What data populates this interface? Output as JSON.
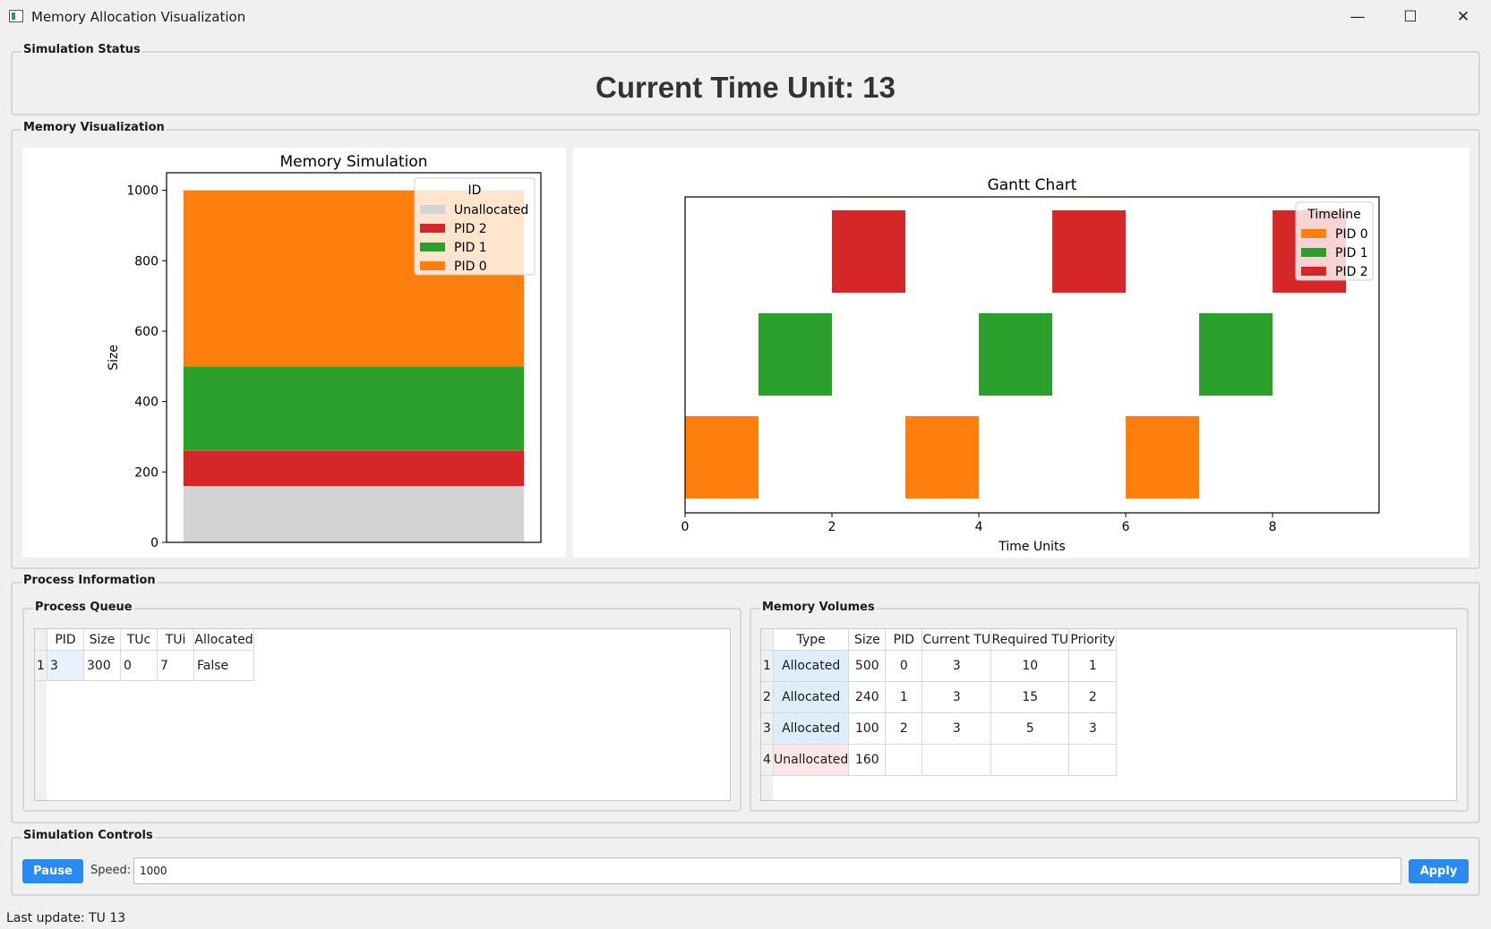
{
  "window": {
    "title": "Memory Allocation Visualization",
    "minimize": "—",
    "maximize": "☐",
    "close": "✕"
  },
  "status": {
    "group_title": "Simulation Status",
    "time_unit": "Current Time Unit: 13"
  },
  "viz": {
    "group_title": "Memory Visualization"
  },
  "chart_data": [
    {
      "type": "bar",
      "stacked": true,
      "title": "Memory Simulation",
      "xlabel": "",
      "ylabel": "Size",
      "ylim": [
        0,
        1050
      ],
      "yticks": [
        "0",
        "200",
        "400",
        "600",
        "800",
        "1000"
      ],
      "grid": false,
      "legend": {
        "title": "ID",
        "position": "top-right",
        "entries": [
          "Unallocated",
          "PID 2",
          "PID 1",
          "PID 0"
        ]
      },
      "series": [
        {
          "name": "Unallocated",
          "values": [
            160
          ],
          "color": "#d3d3d3"
        },
        {
          "name": "PID 2",
          "values": [
            100
          ],
          "color": "#d62728"
        },
        {
          "name": "PID 1",
          "values": [
            240
          ],
          "color": "#2ca02c"
        },
        {
          "name": "PID 0",
          "values": [
            500
          ],
          "color": "#ff7f0e"
        }
      ]
    },
    {
      "type": "gantt",
      "title": "Gantt Chart",
      "xlabel": "Time Units",
      "xlim": [
        0,
        9.45
      ],
      "xticks": [
        "0",
        "2",
        "4",
        "6",
        "8"
      ],
      "grid": false,
      "legend": {
        "title": "Timeline",
        "position": "top-right",
        "entries": [
          "PID 0",
          "PID 1",
          "PID 2"
        ]
      },
      "series": [
        {
          "name": "PID 0",
          "color": "#ff7f0e",
          "row": 0,
          "intervals": [
            [
              0,
              1
            ],
            [
              3,
              4
            ],
            [
              6,
              7
            ]
          ]
        },
        {
          "name": "PID 1",
          "color": "#2ca02c",
          "row": 1,
          "intervals": [
            [
              1,
              2
            ],
            [
              4,
              5
            ],
            [
              7,
              8
            ]
          ]
        },
        {
          "name": "PID 2",
          "color": "#d62728",
          "row": 2,
          "intervals": [
            [
              2,
              3
            ],
            [
              5,
              6
            ],
            [
              8,
              9
            ]
          ]
        }
      ]
    }
  ],
  "process_info": {
    "group_title": "Process Information",
    "queue": {
      "title": "Process Queue",
      "headers": [
        "PID",
        "Size",
        "TUc",
        "TUi",
        "Allocated"
      ],
      "rows": [
        {
          "num": "1",
          "cells": [
            "3",
            "300",
            "0",
            "7",
            "False"
          ]
        }
      ]
    },
    "volumes": {
      "title": "Memory Volumes",
      "headers": [
        "Type",
        "Size",
        "PID",
        "Current TU",
        "Required TU",
        "Priority"
      ],
      "rows": [
        {
          "num": "1",
          "cells": [
            "Allocated",
            "500",
            "0",
            "3",
            "10",
            "1"
          ]
        },
        {
          "num": "2",
          "cells": [
            "Allocated",
            "240",
            "1",
            "3",
            "15",
            "2"
          ]
        },
        {
          "num": "3",
          "cells": [
            "Allocated",
            "100",
            "2",
            "3",
            "5",
            "3"
          ]
        },
        {
          "num": "4",
          "cells": [
            "Unallocated",
            "160",
            "",
            "",
            "",
            ""
          ]
        }
      ],
      "colors": {
        "allocated_bg": "#ddeefa",
        "unallocated_bg": "#fde6e9"
      }
    }
  },
  "controls": {
    "group_title": "Simulation Controls",
    "pause_label": "Pause",
    "speed_label": "Speed:",
    "speed_value": "1000",
    "apply_label": "Apply",
    "accent": "#2a8af0"
  },
  "statusbar": {
    "text": "Last update: TU 13"
  }
}
